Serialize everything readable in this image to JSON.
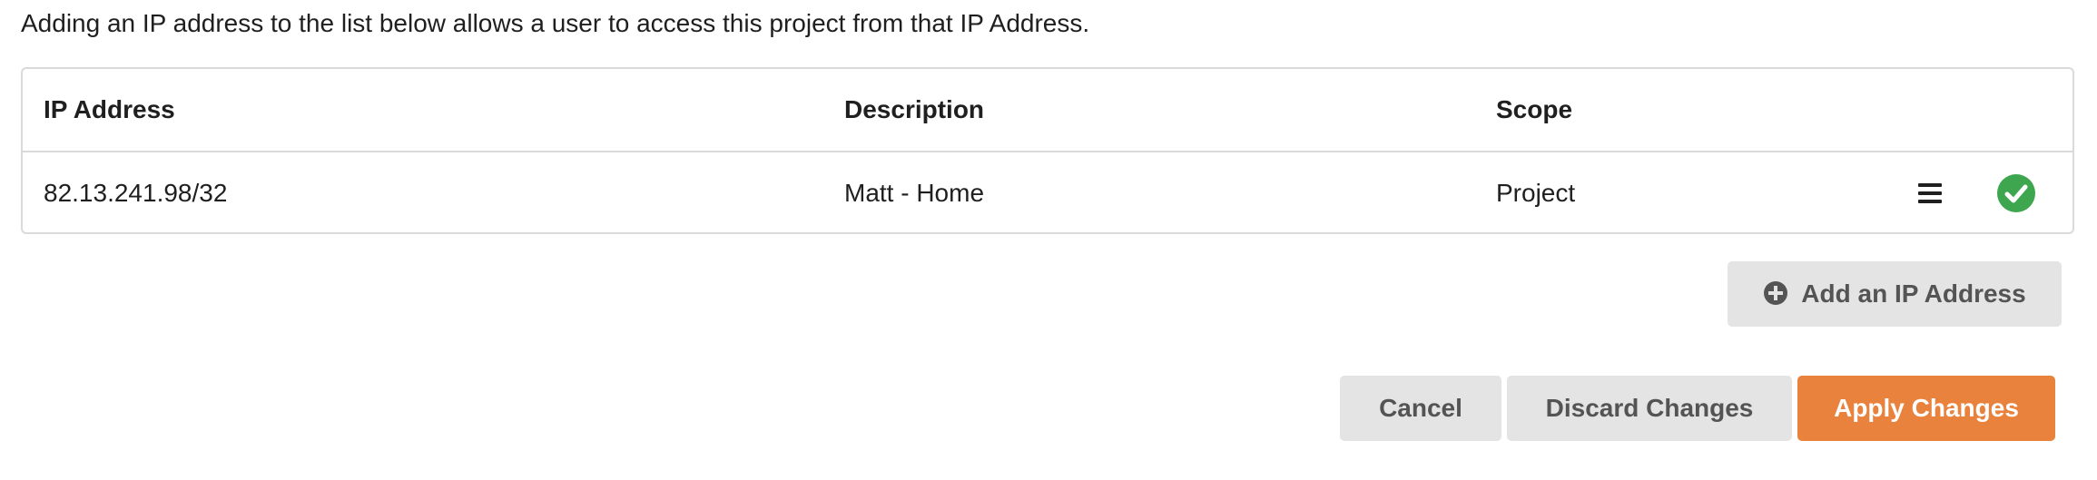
{
  "intro_text": "Adding an IP address to the list below allows a user to access this project from that IP Address.",
  "table": {
    "columns": [
      "IP Address",
      "Description",
      "Scope"
    ],
    "rows": [
      {
        "ip": "82.13.241.98/32",
        "description": "Matt - Home",
        "scope": "Project",
        "actions": [
          "menu-icon",
          "check-circle-icon"
        ]
      }
    ]
  },
  "buttons": {
    "add_ip": "Add an IP Address",
    "cancel": "Cancel",
    "discard": "Discard Changes",
    "apply": "Apply Changes"
  },
  "colors": {
    "accent": "#e8823c",
    "success": "#3fa650",
    "button_grey": "#e4e4e5",
    "border": "#dadada"
  }
}
